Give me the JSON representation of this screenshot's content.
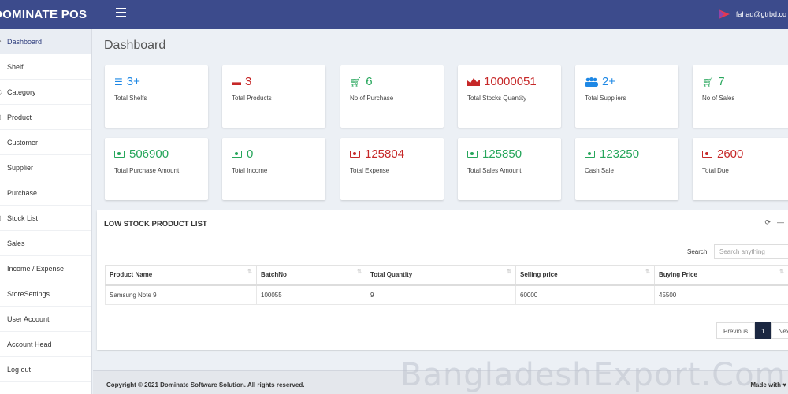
{
  "app": {
    "name": "DOMINATE POS",
    "user": "fahad@gtrbd.co"
  },
  "sidebar": {
    "items": [
      {
        "label": "Dashboard"
      },
      {
        "label": "Shelf"
      },
      {
        "label": "Category"
      },
      {
        "label": "Product"
      },
      {
        "label": "Customer"
      },
      {
        "label": "Supplier"
      },
      {
        "label": "Purchase"
      },
      {
        "label": "Stock List"
      },
      {
        "label": "Sales"
      },
      {
        "label": "Income / Expense"
      },
      {
        "label": "StoreSettings"
      },
      {
        "label": "User Account"
      },
      {
        "label": "Account Head"
      },
      {
        "label": "Log out"
      }
    ]
  },
  "page": {
    "title": "Dashboard"
  },
  "cards": [
    {
      "value": "3+",
      "label": "Total Shelfs",
      "icon": "list-icon",
      "color": "#1e88e5"
    },
    {
      "value": "3",
      "label": "Total Products",
      "icon": "archive-icon",
      "color": "#c62828"
    },
    {
      "value": "6",
      "label": "No of Purchase",
      "icon": "cart-icon",
      "color": "#26a65b"
    },
    {
      "value": "10000051",
      "label": "Total Stocks Quantity",
      "icon": "area-chart-icon",
      "color": "#c62828"
    },
    {
      "value": "2+",
      "label": "Total Suppliers",
      "icon": "users-icon",
      "color": "#1e88e5"
    },
    {
      "value": "7",
      "label": "No of Sales",
      "icon": "cart-icon",
      "color": "#26a65b"
    },
    {
      "value": "506900",
      "label": "Total Purchase Amount",
      "icon": "money-icon",
      "color": "#26a65b"
    },
    {
      "value": "0",
      "label": "Total Income",
      "icon": "money-icon",
      "color": "#26a65b"
    },
    {
      "value": "125804",
      "label": "Total Expense",
      "icon": "money-icon",
      "color": "#c62828"
    },
    {
      "value": "125850",
      "label": "Total Sales Amount",
      "icon": "money-icon",
      "color": "#26a65b"
    },
    {
      "value": "123250",
      "label": "Cash Sale",
      "icon": "money-icon",
      "color": "#26a65b"
    },
    {
      "value": "2600",
      "label": "Total Due",
      "icon": "money-icon",
      "color": "#c62828"
    }
  ],
  "low_stock": {
    "title": "LOW STOCK PRODUCT LIST",
    "search_label": "Search:",
    "search_placeholder": "Search anything",
    "columns": [
      "Product Name",
      "BatchNo",
      "Total Quantity",
      "Selling price",
      "Buying Price"
    ],
    "rows": [
      [
        "Samsung Note 9",
        "100055",
        "9",
        "60000",
        "45500"
      ]
    ],
    "pager": {
      "previous": "Previous",
      "current": "1",
      "next": "Next"
    }
  },
  "footer": {
    "copyright": "Copyright © 2021 Dominate Software Solution. All rights reserved.",
    "made": "Made with ♥"
  },
  "watermark": "BangladeshExport.Com"
}
